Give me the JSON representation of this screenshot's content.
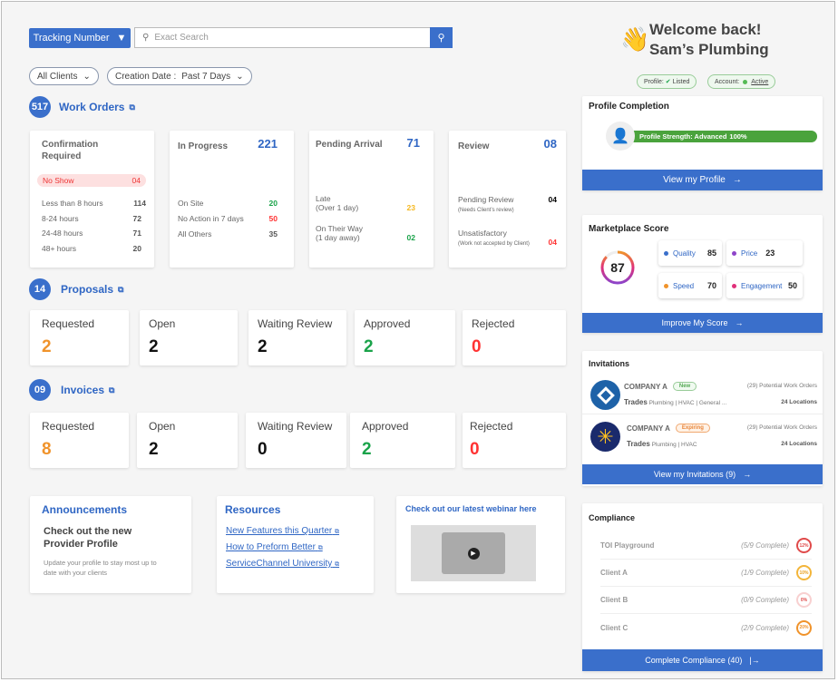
{
  "header": {
    "search_type": "Tracking Number",
    "search_placeholder": "Exact Search",
    "filter_clients": "All Clients",
    "filter_date_label": "Creation Date :",
    "filter_date_value": "Past 7 Days"
  },
  "welcome": {
    "line1": "Welcome back!",
    "line2": "Sam’s Plumbing",
    "profile_label": "Profile:",
    "profile_value": "Listed",
    "account_label": "Account:",
    "account_value": "Active"
  },
  "work_orders": {
    "count": "517",
    "title": "Work Orders",
    "confirmation": {
      "title": "Confirmation Required",
      "no_show_label": "No Show",
      "no_show_value": "04",
      "rows": [
        {
          "label": "Less than 8 hours",
          "value": "114"
        },
        {
          "label": "8-24 hours",
          "value": "72"
        },
        {
          "label": "24-48 hours",
          "value": "71"
        },
        {
          "label": "48+ hours",
          "value": "20"
        }
      ]
    },
    "in_progress": {
      "title": "In Progress",
      "value": "221",
      "rows": [
        {
          "label": "On Site",
          "value": "20"
        },
        {
          "label": "No Action in 7 days",
          "value": "50"
        },
        {
          "label": "All Others",
          "value": "35"
        }
      ]
    },
    "pending_arrival": {
      "title": "Pending Arrival",
      "value": "71",
      "rows": [
        {
          "label": "Late",
          "sub": "(Over 1 day)",
          "value": "23"
        },
        {
          "label": "On Their Way",
          "sub": "(1 day away)",
          "value": "02"
        }
      ]
    },
    "review": {
      "title": "Review",
      "value": "08",
      "rows": [
        {
          "label": "Pending Review",
          "sub": "(Needs Client’s review)",
          "value": "04"
        },
        {
          "label": "Unsatisfactory",
          "sub": "(Work not accepted by Client)",
          "value": "04"
        }
      ]
    }
  },
  "proposals": {
    "count": "14",
    "title": "Proposals",
    "items": [
      {
        "label": "Requested",
        "value": "2"
      },
      {
        "label": "Open",
        "value": "2"
      },
      {
        "label": "Waiting Review",
        "value": "2"
      },
      {
        "label": "Approved",
        "value": "2"
      },
      {
        "label": "Rejected",
        "value": "0"
      }
    ]
  },
  "invoices": {
    "count": "09",
    "title": "Invoices",
    "items": [
      {
        "label": "Requested",
        "value": "8"
      },
      {
        "label": "Open",
        "value": "2"
      },
      {
        "label": "Waiting Review",
        "value": "0"
      },
      {
        "label": "Approved",
        "value": "2"
      },
      {
        "label": "Rejected",
        "value": "0"
      }
    ]
  },
  "announcements": {
    "title": "Announcements",
    "heading": "Check out the new Provider Profile",
    "body": "Update your profile to stay most up to date with your clients"
  },
  "resources": {
    "title": "Resources",
    "links": [
      "New Features this Quarter",
      "How to Preform Better",
      "ServiceChannel University"
    ]
  },
  "webinar": {
    "title": "Check out our latest webinar here"
  },
  "profile_completion": {
    "title": "Profile Completion",
    "strength_label": "Profile Strength: Advanced",
    "strength_value": "100%",
    "progress": 100,
    "button": "View my Profile"
  },
  "marketplace": {
    "title": "Marketplace Score",
    "score": "87",
    "metrics": [
      {
        "label": "Quality",
        "value": "85",
        "color": "#3a6fcb"
      },
      {
        "label": "Price",
        "value": "23",
        "color": "#8e44c9"
      },
      {
        "label": "Speed",
        "value": "70",
        "color": "#f0932b"
      },
      {
        "label": "Engagement",
        "value": "50",
        "color": "#e0307a"
      }
    ],
    "button": "Improve My Score"
  },
  "invitations": {
    "title": "Invitations",
    "items": [
      {
        "company": "COMPANY A",
        "tag": "New",
        "orders": "(29) Potential Work Orders",
        "trades_label": "Trades",
        "trades": "Plumbing | HVAC | General ...",
        "locations": "24 Locations"
      },
      {
        "company": "COMPANY A",
        "tag": "Expiring",
        "orders": "(29) Potential Work Orders",
        "trades_label": "Trades",
        "trades": "Plumbing | HVAC",
        "locations": "24 Locations"
      }
    ],
    "button": "View my Invitations (9)"
  },
  "compliance": {
    "title": "Compliance",
    "items": [
      {
        "name": "TOI Playground",
        "status": "(5/9 Complete)",
        "pct": "12%",
        "color": "#e04a4a"
      },
      {
        "name": "Client A",
        "status": "(1/9 Complete)",
        "pct": "10%",
        "color": "#f3b53a"
      },
      {
        "name": "Client B",
        "status": "(0/9 Complete)",
        "pct": "0%",
        "color": "#f3a0a0"
      },
      {
        "name": "Client C",
        "status": "(2/9 Complete)",
        "pct": "20%",
        "color": "#f0932b"
      }
    ],
    "button": "Complete Compliance (40)"
  },
  "colors": {
    "accent": "#3a6fcb",
    "orange": "#f0932b",
    "green": "#1aa34a",
    "red": "#f33"
  }
}
